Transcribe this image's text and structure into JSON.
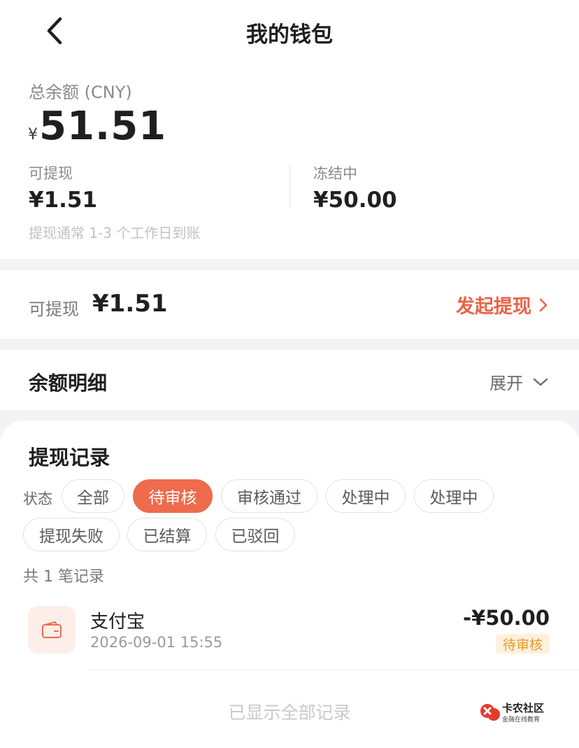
{
  "nav": {
    "title": "我的钱包"
  },
  "balance": {
    "total_label": "总余额 (CNY)",
    "currency_symbol": "¥",
    "total_amount": "51.51",
    "withdrawable_label": "可提现",
    "withdrawable_value": "¥1.51",
    "frozen_label": "冻结中",
    "frozen_value": "¥50.00",
    "hint": "提现通常 1-3 个工作日到账"
  },
  "withdraw": {
    "label": "可提现",
    "value": "¥1.51",
    "action_label": "发起提现"
  },
  "detail": {
    "title": "余额明细",
    "expand_label": "展开"
  },
  "records": {
    "title": "提现记录",
    "status_label": "状态",
    "filters": [
      "全部",
      "待审核",
      "审核通过",
      "处理中",
      "处理中",
      "提现失败",
      "已结算",
      "已驳回"
    ],
    "active_filter": "待审核",
    "count_text": "共 1 笔记录",
    "items": [
      {
        "icon": "wallet-icon",
        "name": "支付宝",
        "time": "2026-09-01 15:55",
        "amount": "-¥50.00",
        "status": "待审核"
      }
    ],
    "footer": "已显示全部记录"
  },
  "watermark": {
    "name": "卡农社区",
    "subtitle": "金融在线教育"
  },
  "colors": {
    "accent": "#ee6b4d",
    "accent_text": "#ea6447",
    "pending_badge_bg": "#fdf1dc",
    "pending_badge_text": "#e89a2a",
    "section_gap": "#f3f3f5"
  }
}
